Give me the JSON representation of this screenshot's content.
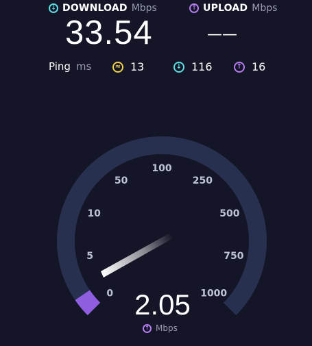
{
  "download": {
    "label": "DOWNLOAD",
    "unit": "Mbps",
    "value": "33.54",
    "icon": "download-arrow-icon",
    "color": "#5ce1e6"
  },
  "upload": {
    "label": "UPLOAD",
    "unit": "Mbps",
    "value": "——",
    "icon": "upload-arrow-icon",
    "color": "#b77cf2"
  },
  "ping": {
    "label": "Ping",
    "unit": "ms",
    "idle": {
      "value": "13",
      "color": "#f2d24b"
    },
    "download": {
      "value": "116",
      "color": "#5ce1e6"
    },
    "upload": {
      "value": "16",
      "color": "#b77cf2"
    }
  },
  "gauge": {
    "ticks": [
      "0",
      "5",
      "10",
      "50",
      "100",
      "250",
      "500",
      "750",
      "1000"
    ],
    "current_value": "2.05",
    "unit": "Mbps",
    "track_color": "#27304f",
    "fill_color": "#8f5de0",
    "progress_fraction": 0.04
  }
}
